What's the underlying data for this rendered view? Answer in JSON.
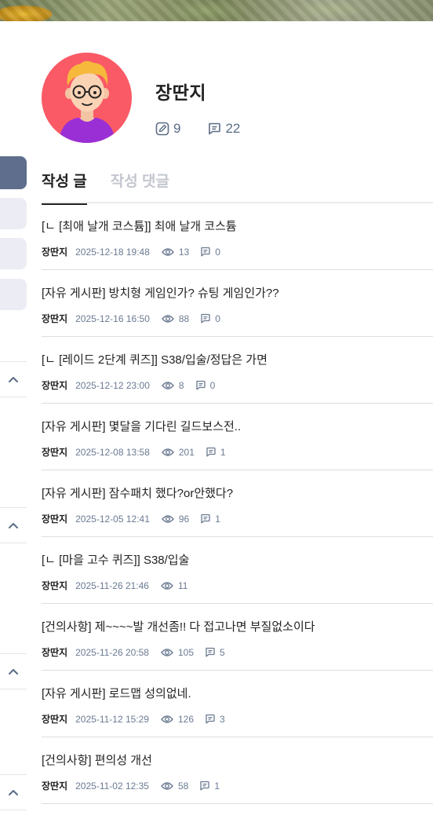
{
  "profile": {
    "name": "장딴지",
    "posts_count": "9",
    "comments_count": "22"
  },
  "tabs": [
    {
      "label": "작성 글",
      "active": true
    },
    {
      "label": "작성 댓글",
      "active": false
    }
  ],
  "posts": [
    {
      "title": "[ㄴ [최애 날개 코스튬]] 최애 날개 코스튬",
      "author": "장딴지",
      "date": "2025-12-18 19:48",
      "views": "13",
      "comments": "0"
    },
    {
      "title": "[자유 게시판] 방치형 게임인가? 슈팅 게임인가??",
      "author": "장딴지",
      "date": "2025-12-16 16:50",
      "views": "88",
      "comments": "0"
    },
    {
      "title": "[ㄴ [레이드 2단계 퀴즈]] S38/입술/정답은 가면",
      "author": "장딴지",
      "date": "2025-12-12 23:00",
      "views": "8",
      "comments": "0"
    },
    {
      "title": "[자유 게시판] 몇달을 기다린 길드보스전..",
      "author": "장딴지",
      "date": "2025-12-08 13:58",
      "views": "201",
      "comments": "1"
    },
    {
      "title": "[자유 게시판] 잠수패치 했다?or안했다?",
      "author": "장딴지",
      "date": "2025-12-05 12:41",
      "views": "96",
      "comments": "1"
    },
    {
      "title": "[ㄴ [마을 고수 퀴즈]] S38/입술",
      "author": "장딴지",
      "date": "2025-11-26 21:46",
      "views": "11",
      "comments": null
    },
    {
      "title": "[건의사항] 제~~~~발 개선좀!! 다 접고나면 부질없소이다",
      "author": "장딴지",
      "date": "2025-11-26 20:58",
      "views": "105",
      "comments": "5"
    },
    {
      "title": "[자유 게시판] 로드맵 성의없네.",
      "author": "장딴지",
      "date": "2025-11-12 15:29",
      "views": "126",
      "comments": "3"
    },
    {
      "title": "[건의사항] 편의성 개선",
      "author": "장딴지",
      "date": "2025-11-02 12:35",
      "views": "58",
      "comments": "1"
    }
  ],
  "colors": {
    "accent": "#5f6e8c",
    "avatar_bg": "#fa5a66",
    "meta_text": "#6b7a92"
  }
}
